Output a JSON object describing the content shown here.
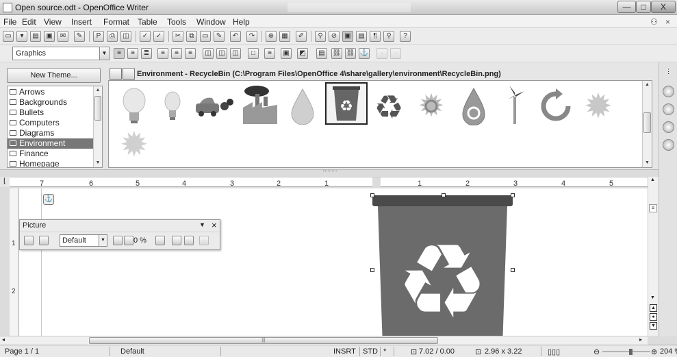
{
  "window": {
    "title": "Open source.odt - OpenOffice Writer",
    "minimize": "—",
    "maximize": "□",
    "close": "X"
  },
  "menubar": {
    "items": [
      "File",
      "Edit",
      "View",
      "Insert",
      "Format",
      "Table",
      "Tools",
      "Window",
      "Help"
    ],
    "right_icon": "close-document-icon",
    "close_doc": "×"
  },
  "toolbar": {
    "style_combo": "Graphics"
  },
  "gallery": {
    "new_theme_label": "New Theme...",
    "path_label": "Environment - RecycleBin (C:\\Program Files\\OpenOffice 4\\share\\gallery\\environment\\RecycleBin.png)",
    "themes": [
      "Arrows",
      "Backgrounds",
      "Bullets",
      "Computers",
      "Diagrams",
      "Environment",
      "Finance",
      "Homepage"
    ],
    "selected_theme": "Environment",
    "items": [
      "light-bulb",
      "light-bulb-small",
      "car-exhaust",
      "factory",
      "water-drop",
      "recycle-bin",
      "recycle-arrows",
      "sun-gear",
      "water-drop-cycle",
      "wind-turbine",
      "circular-arrow",
      "sun",
      "sun-small"
    ],
    "selected_item": "recycle-bin"
  },
  "ruler": {
    "left_numbers": [
      "7",
      "6",
      "5",
      "4",
      "3",
      "2",
      "1"
    ],
    "right_numbers": [
      "1",
      "2",
      "3",
      "4",
      "5"
    ],
    "vertical_numbers": [
      "1",
      "2"
    ]
  },
  "picture_toolbar": {
    "title": "Picture",
    "menu_arrow": "▼",
    "close": "×",
    "mode_combo": "Default",
    "transparency": "0 %"
  },
  "statusbar": {
    "page": "Page 1 / 1",
    "page_style": "Default",
    "insert_mode": "INSRT",
    "selection_mode": "STD",
    "modified": "*",
    "position": "7.02 / 0.00",
    "size": "2.96 x 3.22",
    "zoom": "204 %"
  },
  "colors": {
    "bin_dark": "#555555",
    "bin_body": "#6b6b6b",
    "selection": "#777777"
  }
}
